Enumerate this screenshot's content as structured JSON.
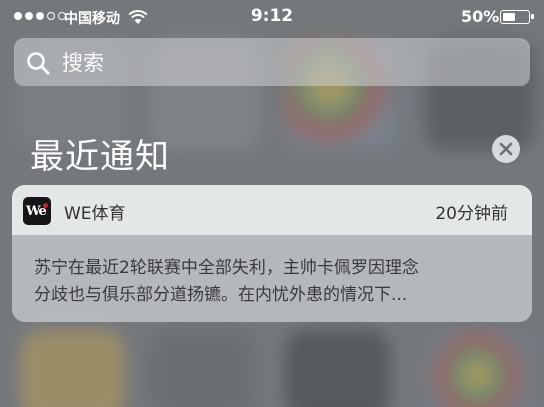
{
  "status_bar": {
    "carrier": "中国移动",
    "time": "9:12",
    "battery_percent": "50%",
    "battery_level": 0.5,
    "signal_bars_filled": 3,
    "signal_bars_total": 5
  },
  "search": {
    "placeholder": "搜索",
    "icon": "search-icon"
  },
  "section": {
    "title": "最近通知",
    "clear_icon": "close-icon"
  },
  "notification": {
    "app_name": "WE体育",
    "time": "20分钟前",
    "message_lines": [
      "苏宁在最近2轮联赛中全部失利，主帅卡佩罗因理念",
      "分歧也与俱乐部分道扬镳。在内忧外患的情况下..."
    ],
    "app_icon_text": "We"
  }
}
